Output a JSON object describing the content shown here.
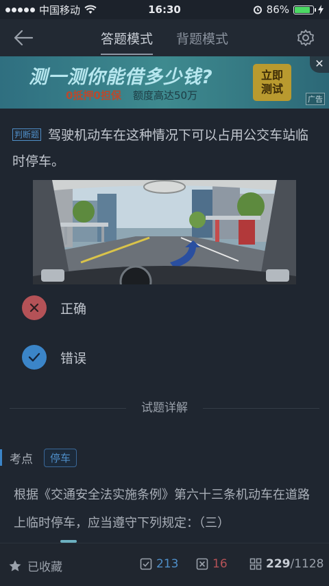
{
  "status_bar": {
    "carrier": "中国移动",
    "time": "16:30",
    "battery": "86%",
    "battery_level": 0.86
  },
  "nav": {
    "tabs": [
      {
        "label": "答题模式",
        "active": true
      },
      {
        "label": "背题模式",
        "active": false
      }
    ]
  },
  "ad": {
    "title": "测一测你能借多少钱?",
    "sub1": "0抵押0担保",
    "sub2": "额度高达50万",
    "cta_line1": "立即",
    "cta_line2": "测试",
    "tag": "广告",
    "close": "✕"
  },
  "question": {
    "type": "判断题",
    "text": "驾驶机动车在这种情况下可以占用公交车站临时停车。"
  },
  "options": [
    {
      "label": "正确",
      "icon": "cross-icon",
      "state": "wrong"
    },
    {
      "label": "错误",
      "icon": "check-icon",
      "state": "correct"
    }
  ],
  "details": {
    "title": "试题详解",
    "keypoint_label": "考点",
    "keypoint_tag": "停车",
    "explanation": "根据《交通安全法实施条例》第六十三条机动车在道路上临时停车，应当遵守下列规定：（三）"
  },
  "bottom": {
    "bookmark_label": "已收藏",
    "correct_count": "213",
    "wrong_count": "16",
    "progress_current": "229",
    "progress_total": "/1128"
  },
  "colors": {
    "background": "#1f2630",
    "accent": "#3b85c8",
    "wrong": "#b45257"
  }
}
